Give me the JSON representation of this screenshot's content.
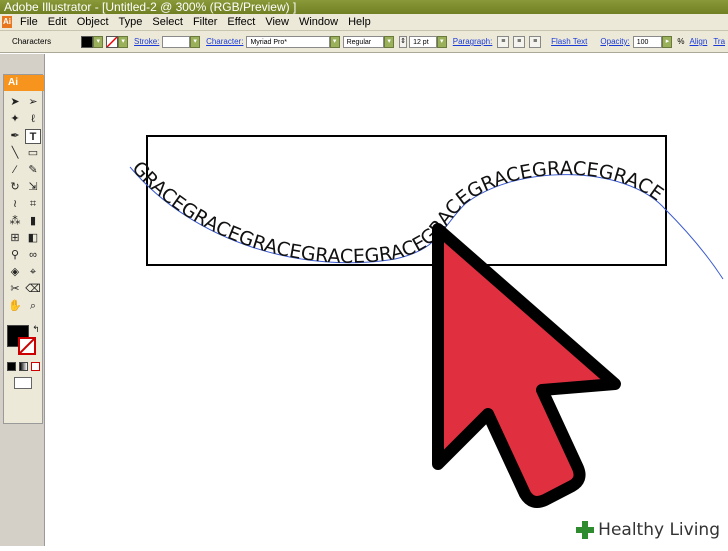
{
  "window": {
    "title": "Adobe Illustrator - [Untitled-2 @ 300% (RGB/Preview) ]"
  },
  "menu": {
    "items": [
      "File",
      "Edit",
      "Object",
      "Type",
      "Select",
      "Filter",
      "Effect",
      "View",
      "Window",
      "Help"
    ]
  },
  "control_bar": {
    "panel_label": "Characters",
    "stroke_label": "Stroke:",
    "character_label": "Character:",
    "font_family": "Myriad Pro*",
    "font_style": "Regular",
    "font_size": "12 pt",
    "paragraph_label": "Paragraph:",
    "flash_text_label": "Flash Text",
    "opacity_label": "Opacity:",
    "opacity_value": "100",
    "opacity_unit": "%",
    "align_label": "Align",
    "transform_label": "Tra"
  },
  "toolbox": {
    "logo": "Ai"
  },
  "canvas": {
    "path_text": "GRACEGRACEGRACEGRACEGRACEGRACEGRACEGRACEGRACE",
    "pointer_color": "#e03040"
  },
  "watermark": {
    "brand": "Healthy Living"
  },
  "colors": {
    "titlebar": "#7a8a2a",
    "accent": "#f7941d",
    "pointer": "#e03040",
    "path": "#3a5ad0"
  }
}
